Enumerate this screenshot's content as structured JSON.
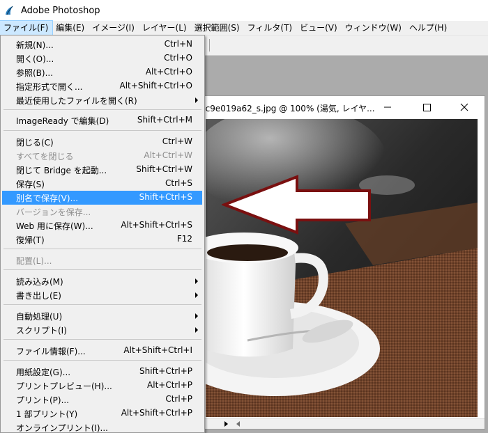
{
  "app": {
    "title": "Adobe Photoshop"
  },
  "menubar": [
    "ファイル(F)",
    "編集(E)",
    "イメージ(I)",
    "レイヤー(L)",
    "選択範囲(S)",
    "フィルタ(T)",
    "ビュー(V)",
    "ウィンドウ(W)",
    "ヘルプ(H)"
  ],
  "document": {
    "title": "2c9e019a62_s.jpg @ 100% (湯気, レイヤ..."
  },
  "file_menu": {
    "items": [
      {
        "label": "新規(N)...",
        "shortcut": "Ctrl+N"
      },
      {
        "label": "開く(O)...",
        "shortcut": "Ctrl+O"
      },
      {
        "label": "参照(B)...",
        "shortcut": "Alt+Ctrl+O"
      },
      {
        "label": "指定形式で開く...",
        "shortcut": "Alt+Shift+Ctrl+O"
      },
      {
        "label": "最近使用したファイルを開く(R)",
        "shortcut": ""
      },
      {
        "label": "ImageReady で編集(D)",
        "shortcut": "Shift+Ctrl+M"
      },
      {
        "label": "閉じる(C)",
        "shortcut": "Ctrl+W"
      },
      {
        "label": "すべてを閉じる",
        "shortcut": "Alt+Ctrl+W"
      },
      {
        "label": "閉じて Bridge を起動...",
        "shortcut": "Shift+Ctrl+W"
      },
      {
        "label": "保存(S)",
        "shortcut": "Ctrl+S"
      },
      {
        "label": "別名で保存(V)...",
        "shortcut": "Shift+Ctrl+S"
      },
      {
        "label": "バージョンを保存...",
        "shortcut": ""
      },
      {
        "label": "Web 用に保存(W)...",
        "shortcut": "Alt+Shift+Ctrl+S"
      },
      {
        "label": "復帰(T)",
        "shortcut": "F12"
      },
      {
        "label": "配置(L)...",
        "shortcut": ""
      },
      {
        "label": "読み込み(M)",
        "shortcut": ""
      },
      {
        "label": "書き出し(E)",
        "shortcut": ""
      },
      {
        "label": "自動処理(U)",
        "shortcut": ""
      },
      {
        "label": "スクリプト(I)",
        "shortcut": ""
      },
      {
        "label": "ファイル情報(F)...",
        "shortcut": "Alt+Shift+Ctrl+I"
      },
      {
        "label": "用紙設定(G)...",
        "shortcut": "Shift+Ctrl+P"
      },
      {
        "label": "プリントプレビュー(H)...",
        "shortcut": "Alt+Ctrl+P"
      },
      {
        "label": "プリント(P)...",
        "shortcut": "Ctrl+P"
      },
      {
        "label": "1 部プリント(Y)",
        "shortcut": "Alt+Shift+Ctrl+P"
      },
      {
        "label": "オンラインプリント(I)...",
        "shortcut": ""
      }
    ]
  },
  "colors": {
    "highlight": "#3399ff",
    "annotation_arrow": "#7a1010"
  }
}
